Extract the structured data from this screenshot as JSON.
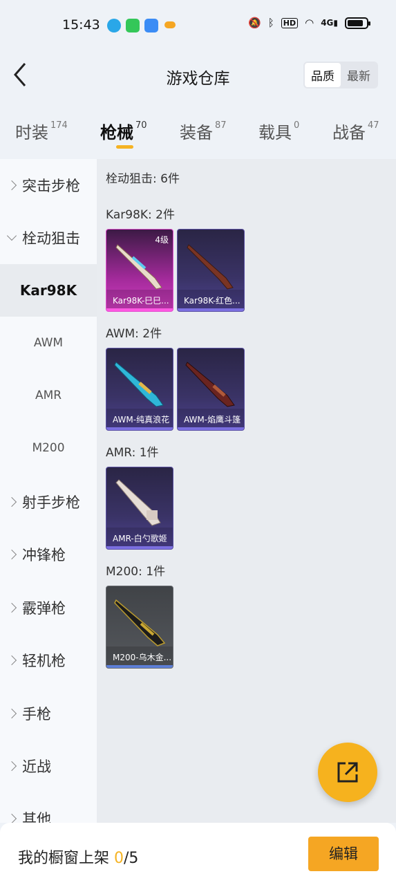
{
  "status_bar": {
    "time": "15:43",
    "hd": "HD",
    "network": "4G"
  },
  "header": {
    "title": "游戏仓库",
    "sort": [
      "品质",
      "最新"
    ]
  },
  "tabs": [
    {
      "label": "时装",
      "count": "174"
    },
    {
      "label": "枪械",
      "count": "70"
    },
    {
      "label": "装备",
      "count": "87"
    },
    {
      "label": "载具",
      "count": "0"
    },
    {
      "label": "战备",
      "count": "47"
    }
  ],
  "sidebar": [
    {
      "label": "突击步枪"
    },
    {
      "label": "栓动狙击"
    },
    {
      "label": "Kar98K"
    },
    {
      "label": "AWM"
    },
    {
      "label": "AMR"
    },
    {
      "label": "M200"
    },
    {
      "label": "射手步枪"
    },
    {
      "label": "冲锋枪"
    },
    {
      "label": "霰弹枪"
    },
    {
      "label": "轻机枪"
    },
    {
      "label": "手枪"
    },
    {
      "label": "近战"
    },
    {
      "label": "其他"
    }
  ],
  "content": {
    "category_title": "栓动狙击: 6件",
    "sections": [
      {
        "title": "Kar98K: 2件",
        "items": [
          {
            "name": "Kar98K-巳巳...",
            "level": "4级"
          },
          {
            "name": "Kar98K-红色..."
          }
        ]
      },
      {
        "title": "AWM: 2件",
        "items": [
          {
            "name": "AWM-纯真浪花"
          },
          {
            "name": "AWM-焰鹰斗篷"
          }
        ]
      },
      {
        "title": "AMR: 1件",
        "items": [
          {
            "name": "AMR-白勺歌姬"
          }
        ]
      },
      {
        "title": "M200: 1件",
        "items": [
          {
            "name": "M200-乌木金..."
          }
        ]
      }
    ]
  },
  "footer": {
    "label": "我的橱窗上架",
    "current": "0",
    "total": "/5",
    "edit": "编辑"
  }
}
